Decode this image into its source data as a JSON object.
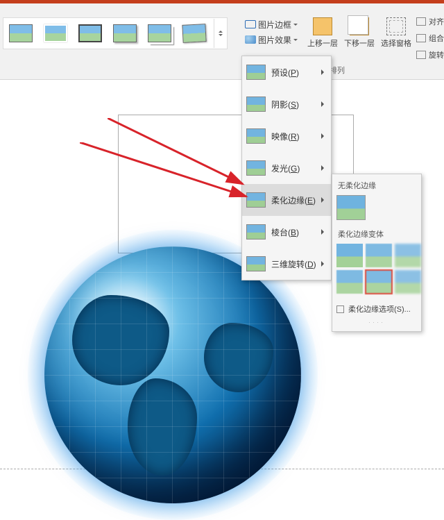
{
  "ribbon": {
    "picture_border_label": "图片边框",
    "picture_effect_label": "图片效果",
    "bring_forward_label": "上移一层",
    "send_backward_label": "下移一层",
    "selection_pane_label": "选择窗格",
    "arrange_section_label": "排列",
    "align_label": "对齐",
    "group_label": "组合",
    "rotate_label": "旋转"
  },
  "effects_menu": {
    "preset": {
      "text": "预设(",
      "key": "P",
      "tail": ")"
    },
    "shadow": {
      "text": "阴影(",
      "key": "S",
      "tail": ")"
    },
    "reflection": {
      "text": "映像(",
      "key": "R",
      "tail": ")"
    },
    "glow": {
      "text": "发光(",
      "key": "G",
      "tail": ")"
    },
    "soft_edges": {
      "text": "柔化边缘(",
      "key": "E",
      "tail": ")"
    },
    "bevel": {
      "text": "棱台(",
      "key": "B",
      "tail": ")"
    },
    "rotation_3d": {
      "text": "三维旋转(",
      "key": "D",
      "tail": ")"
    }
  },
  "soft_edges_submenu": {
    "no_soft_header": "无柔化边缘",
    "variants_header": "柔化边缘变体",
    "options_label": "柔化边缘选项(S)..."
  }
}
